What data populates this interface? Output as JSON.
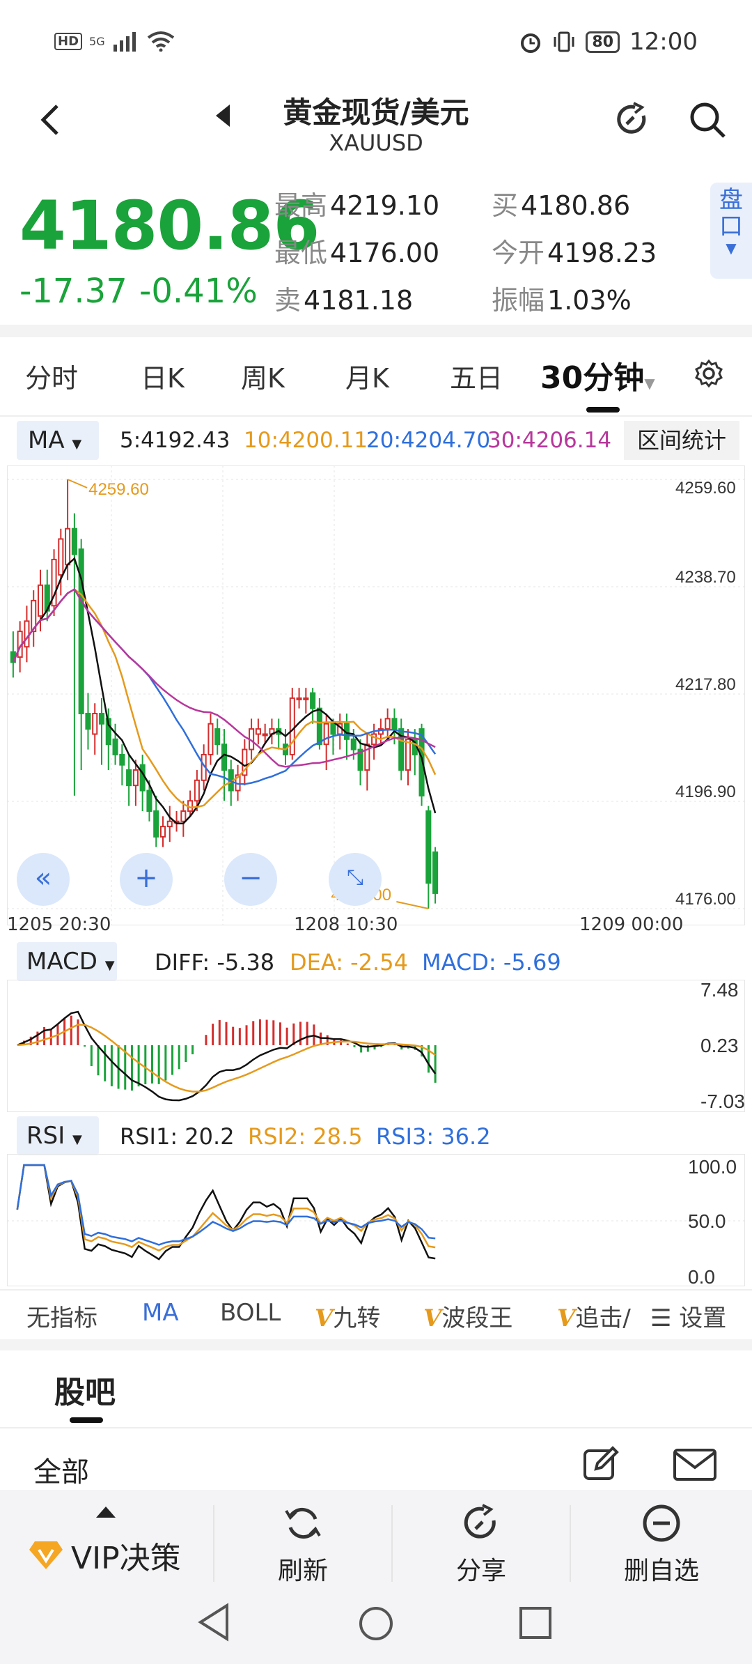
{
  "status": {
    "hd": "HD",
    "signal": "5G",
    "battery": "80",
    "time": "12:00"
  },
  "header": {
    "title": "黄金现货/美元",
    "subtitle": "XAUUSD"
  },
  "quote": {
    "price": "4180.86",
    "change": "-17.37",
    "change_pct": "-0.41%",
    "high_label": "最高",
    "high": "4219.10",
    "low_label": "最低",
    "low": "4176.00",
    "sell_label": "卖",
    "sell": "4181.18",
    "buy_label": "买",
    "buy": "4180.86",
    "open_label": "今开",
    "open": "4198.23",
    "amp_label": "振幅",
    "amp": "1.03%",
    "pankou": [
      "盘",
      "口"
    ]
  },
  "tabs": [
    "分时",
    "日K",
    "周K",
    "月K",
    "五日",
    "30分钟"
  ],
  "ma_legend": {
    "selector": "MA",
    "ma5": "5:4192.43",
    "ma10": "10:4200.11",
    "ma20": "20:4204.70",
    "ma30": "30:4206.14",
    "range_button": "区间统计"
  },
  "colors": {
    "up": "#d42d2d",
    "down": "#1aa33a",
    "ma5": "#111111",
    "ma10": "#e59a1c",
    "ma20": "#2f6fdc",
    "ma30": "#b8379c",
    "accent": "#3a6fd8"
  },
  "chart_data": [
    {
      "type": "candlestick",
      "y_ticks": [
        "4259.60",
        "4238.70",
        "4217.80",
        "4196.90",
        "4176.00"
      ],
      "ylim": [
        4176.0,
        4259.6
      ],
      "x_labels": [
        "1205  20:30",
        "1208  10:30",
        "1209  00:00"
      ],
      "high_annotation": "4259.60",
      "low_annotation": "4176.00",
      "candles": [
        [
          4226,
          4224,
          4230,
          4221
        ],
        [
          4225,
          4230,
          4232,
          4222
        ],
        [
          4227,
          4232,
          4235,
          4224
        ],
        [
          4230,
          4236,
          4238,
          4227
        ],
        [
          4233,
          4239,
          4242,
          4230
        ],
        [
          4239,
          4234,
          4242,
          4232
        ],
        [
          4235,
          4244,
          4246,
          4233
        ],
        [
          4241,
          4248,
          4250,
          4237
        ],
        [
          4243,
          4250,
          4259.6,
          4240
        ],
        [
          4250,
          4245,
          4253,
          4198
        ],
        [
          4246,
          4214,
          4248,
          4203
        ],
        [
          4214,
          4211,
          4218,
          4207
        ],
        [
          4210,
          4214,
          4216,
          4206
        ],
        [
          4214,
          4212,
          4217,
          4204
        ],
        [
          4213,
          4208,
          4215,
          4203
        ],
        [
          4209,
          4206,
          4212,
          4204
        ],
        [
          4206,
          4204,
          4208,
          4200
        ],
        [
          4203,
          4200,
          4206,
          4196
        ],
        [
          4200,
          4203,
          4205,
          4196
        ],
        [
          4204,
          4199,
          4206,
          4195
        ],
        [
          4199,
          4195,
          4201,
          4193
        ],
        [
          4195,
          4190,
          4198,
          4188
        ],
        [
          4190,
          4192,
          4194,
          4188
        ],
        [
          4192,
          4193,
          4196,
          4189
        ],
        [
          4193,
          4193,
          4195,
          4191
        ],
        [
          4193,
          4195,
          4197,
          4190
        ],
        [
          4195,
          4197,
          4199,
          4194
        ],
        [
          4197,
          4201,
          4203,
          4195
        ],
        [
          4201,
          4206,
          4208,
          4199
        ],
        [
          4206,
          4212,
          4214,
          4204
        ],
        [
          4211,
          4208,
          4213,
          4206
        ],
        [
          4208,
          4203,
          4211,
          4197
        ],
        [
          4203,
          4199,
          4205,
          4196
        ],
        [
          4199,
          4202,
          4204,
          4197
        ],
        [
          4202,
          4207,
          4209,
          4200
        ],
        [
          4207,
          4211,
          4213,
          4205
        ],
        [
          4210,
          4211,
          4213,
          4208
        ],
        [
          4210,
          4210,
          4212,
          4208
        ],
        [
          4210,
          4211,
          4213,
          4208
        ],
        [
          4211,
          4210,
          4213,
          4207
        ],
        [
          4208,
          4206,
          4211,
          4204
        ],
        [
          4206,
          4217,
          4219,
          4205
        ],
        [
          4217,
          4217,
          4219,
          4215
        ],
        [
          4217,
          4217,
          4219,
          4214
        ],
        [
          4218,
          4215,
          4219,
          4212
        ],
        [
          4215,
          4208,
          4217,
          4207
        ],
        [
          4208,
          4212,
          4214,
          4203
        ],
        [
          4212,
          4210,
          4213,
          4206
        ],
        [
          4210,
          4212,
          4214,
          4207
        ],
        [
          4212,
          4209,
          4214,
          4205
        ],
        [
          4209,
          4207,
          4211,
          4205
        ],
        [
          4207,
          4203,
          4209,
          4200
        ],
        [
          4203,
          4208,
          4210,
          4199
        ],
        [
          4208,
          4210,
          4212,
          4205
        ],
        [
          4210,
          4211,
          4213,
          4208
        ],
        [
          4211,
          4213,
          4215,
          4209
        ],
        [
          4213,
          4211,
          4215,
          4208
        ],
        [
          4211,
          4203,
          4213,
          4201
        ],
        [
          4203,
          4209,
          4211,
          4200
        ],
        [
          4209,
          4206,
          4211,
          4202
        ],
        [
          4211,
          4198,
          4212,
          4196
        ],
        [
          4195,
          4181,
          4196,
          4176
        ],
        [
          4187,
          4179,
          4188,
          4177
        ]
      ]
    },
    {
      "type": "macd",
      "selector": "MACD",
      "diff": "DIFF: -5.38",
      "dea": "DEA: -2.54",
      "macd": "MACD: -5.69",
      "y_ticks": [
        "7.48",
        "0.23",
        "-7.03"
      ],
      "ylim": [
        -7.03,
        7.48
      ]
    },
    {
      "type": "rsi",
      "selector": "RSI",
      "rsi1": "RSI1: 20.2",
      "rsi2": "RSI2: 28.5",
      "rsi3": "RSI3: 36.2",
      "y_ticks": [
        "100.0",
        "50.0",
        "0.0"
      ],
      "ylim": [
        0,
        100
      ]
    }
  ],
  "indicator_tabs": [
    "无指标",
    "MA",
    "BOLL",
    "九转",
    "波段王",
    "追击/"
  ],
  "indicator_settings": "设置",
  "forum": {
    "title": "股吧",
    "filter": "全部"
  },
  "bottom_nav": {
    "vip": "VIP决策",
    "refresh": "刷新",
    "share": "分享",
    "remove": "删自选"
  }
}
